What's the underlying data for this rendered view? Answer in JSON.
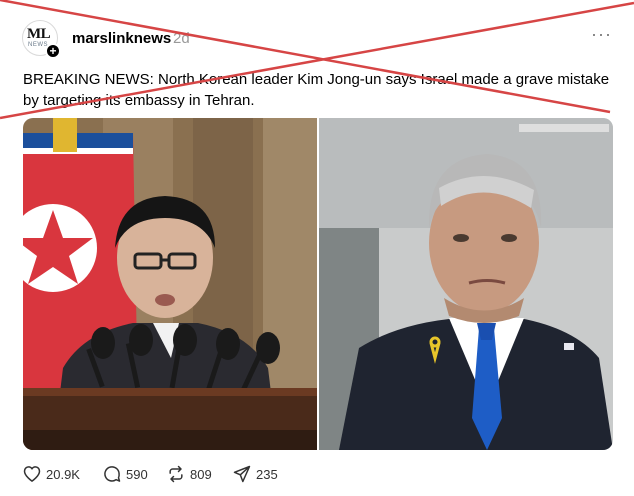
{
  "post": {
    "username": "marslinknews",
    "time": "2d",
    "avatar_text": "ML",
    "avatar_subtext": "NEWS",
    "more_label": "···",
    "text": "BREAKING NEWS: North Korean leader Kim Jong-un says Israel made a grave mistake by targeting its embassy in Tehran."
  },
  "actions": {
    "likes": "20.9K",
    "comments": "590",
    "reposts": "809",
    "shares": "235"
  },
  "icons": {
    "like": "heart-icon",
    "comment": "comment-bubble-icon",
    "repost": "repost-icon",
    "share": "send-icon",
    "more": "more-options-icon",
    "follow": "plus-icon"
  },
  "colors": {
    "cross_line": "#d64545",
    "muted_text": "#999999"
  }
}
